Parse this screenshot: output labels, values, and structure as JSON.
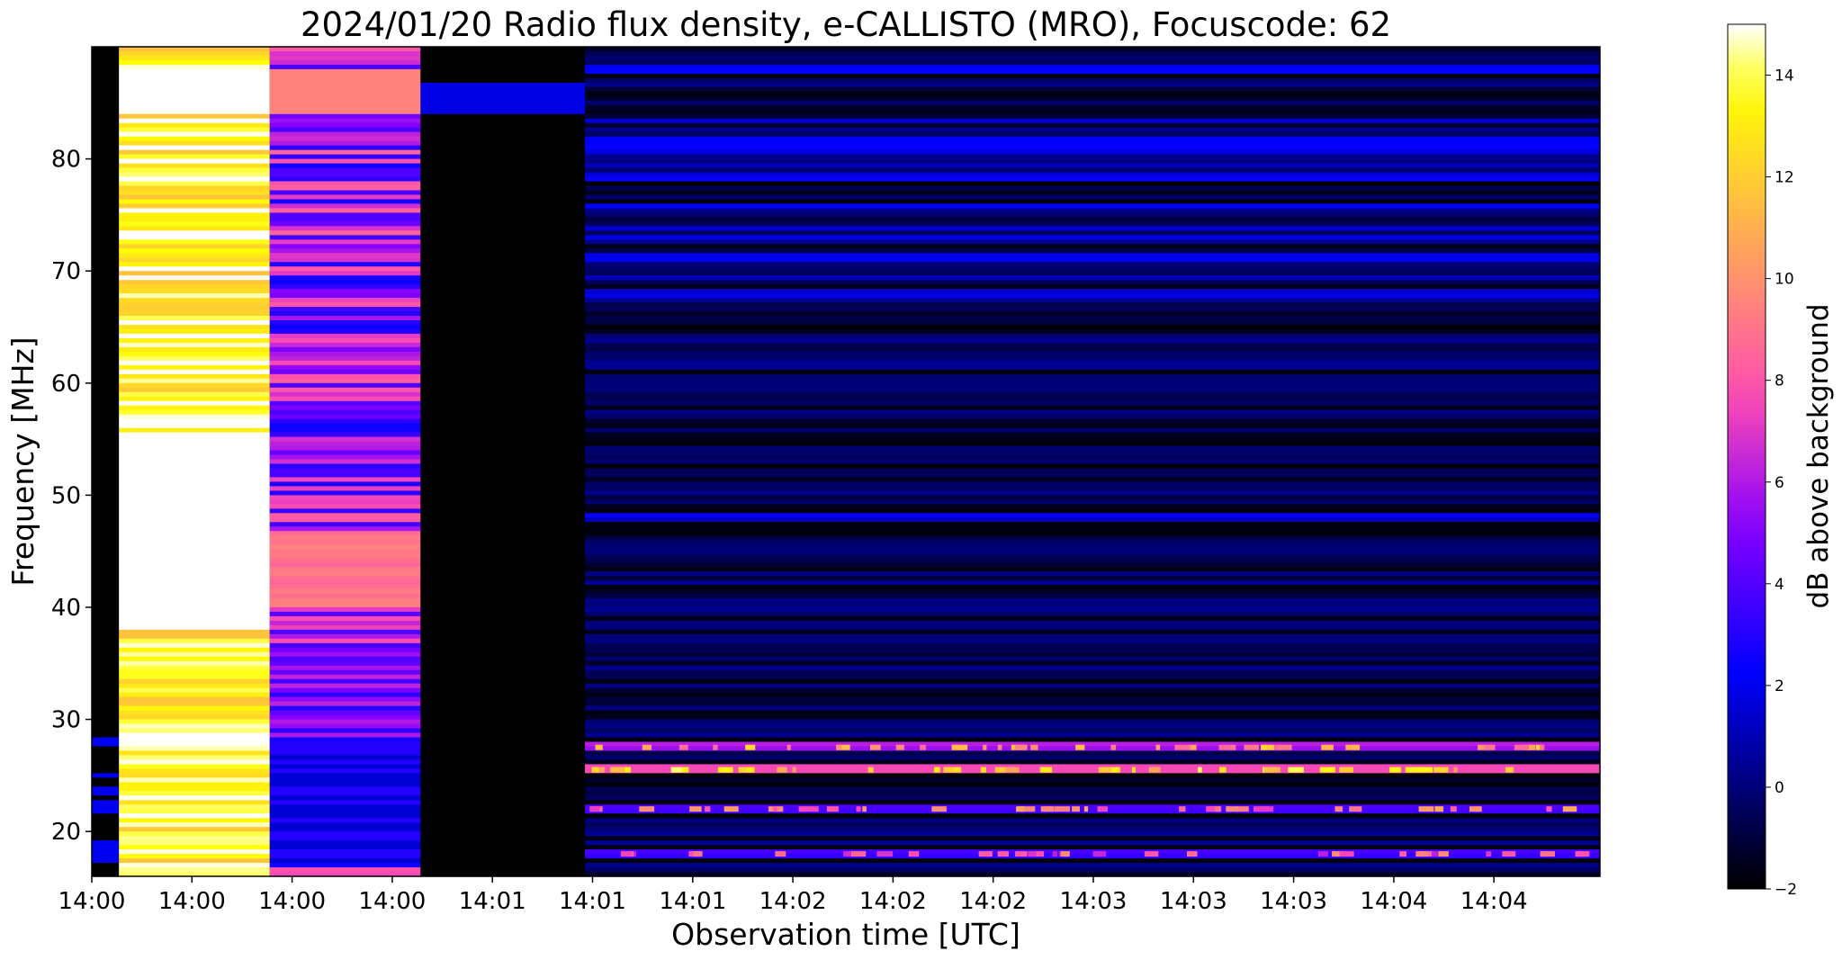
{
  "chart_data": {
    "type": "heatmap",
    "title": "2024/01/20  Radio flux density, e-CALLISTO (MRO), Focuscode: 62",
    "xlabel": "Observation time [UTC]",
    "ylabel": "Frequency [MHz]",
    "colorbar_label": "dB above background",
    "x_tick_labels": [
      "14:00",
      "14:00",
      "14:00",
      "14:00",
      "14:01",
      "14:01",
      "14:01",
      "14:02",
      "14:02",
      "14:02",
      "14:03",
      "14:03",
      "14:03",
      "14:04",
      "14:04"
    ],
    "y_ticks": [
      20,
      30,
      40,
      50,
      60,
      70,
      80
    ],
    "ylim": [
      16,
      90
    ],
    "colorbar_ticks": [
      -2,
      0,
      2,
      4,
      6,
      8,
      10,
      12,
      14
    ],
    "clim": [
      -2,
      15
    ],
    "colormap": "gnuplot2",
    "segments": [
      {
        "name": "",
        "t": [
          0.0,
          0.018
        ],
        "mean_db": -1.5
      },
      {
        "name": "",
        "t": [
          0.018,
          0.118
        ],
        "mean_db": 13.5
      },
      {
        "name": "",
        "t": [
          0.118,
          0.218
        ],
        "mean_db": 5.5
      },
      {
        "name": "",
        "t": [
          0.218,
          0.327
        ],
        "mean_db": -2.0
      },
      {
        "name": "",
        "t": [
          0.327,
          1.0
        ],
        "mean_db": 0.0
      }
    ],
    "features": [
      {
        "freq_mhz": 27.5,
        "db": 6.5
      },
      {
        "freq_mhz": 25.5,
        "db": 8.5
      },
      {
        "freq_mhz": 22.0,
        "db": 5.0
      },
      {
        "freq_mhz": 18.0,
        "db": 4.0
      },
      {
        "freq_mhz": 48.0,
        "db": 2.5
      },
      {
        "freq_mhz": 68.0,
        "db": 2.0
      },
      {
        "freq_mhz": 81.0,
        "db": 2.5
      },
      {
        "freq_mhz": 88.0,
        "db": 3.0
      }
    ]
  }
}
